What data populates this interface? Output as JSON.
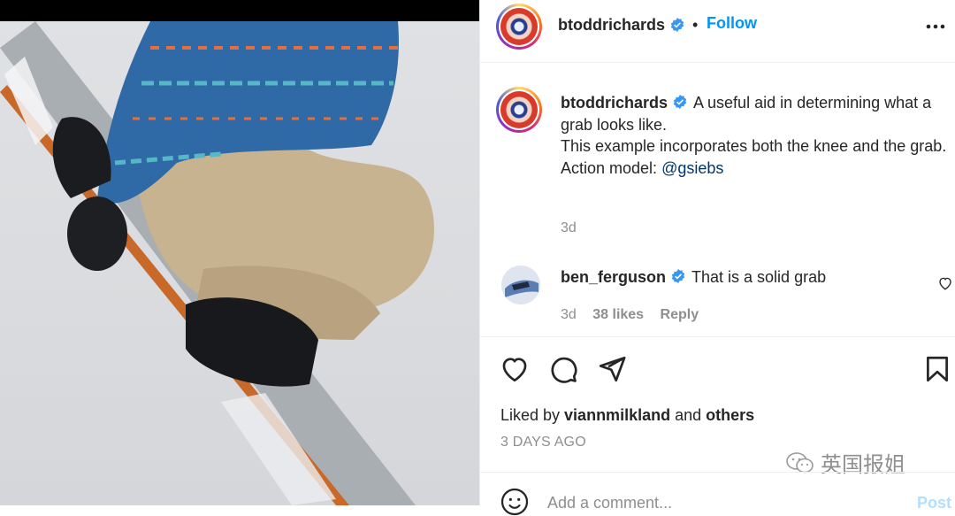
{
  "post": {
    "author": "btoddrichards",
    "follow_label": "Follow",
    "dot": "•",
    "more_icon": "more-options-icon"
  },
  "caption": {
    "author": "btoddrichards",
    "text_1": "A useful aid in determining what a grab looks like.",
    "text_2": "This example incorporates both the knee and the grab.",
    "text_3_prefix": "Action model: ",
    "mention": "@gsiebs",
    "time": "3d"
  },
  "comment": {
    "author": "ben_ferguson",
    "text": "That is a solid grab",
    "time": "3d",
    "likes": "38 likes",
    "reply": "Reply"
  },
  "actions": {
    "like_icon": "heart-icon",
    "comment_icon": "comment-icon",
    "share_icon": "send-icon",
    "save_icon": "bookmark-icon"
  },
  "likes": {
    "prefix": "Liked by ",
    "user": "viannmilkland",
    "and": " and ",
    "others": "others"
  },
  "date": "3 DAYS AGO",
  "watermark": "英国报姐",
  "add_comment": {
    "placeholder": "Add a comment...",
    "post_label": "Post"
  },
  "colors": {
    "accent": "#0095f6",
    "verified": "#3897f0",
    "mention": "#00376b",
    "muted": "#8e8e8e"
  }
}
